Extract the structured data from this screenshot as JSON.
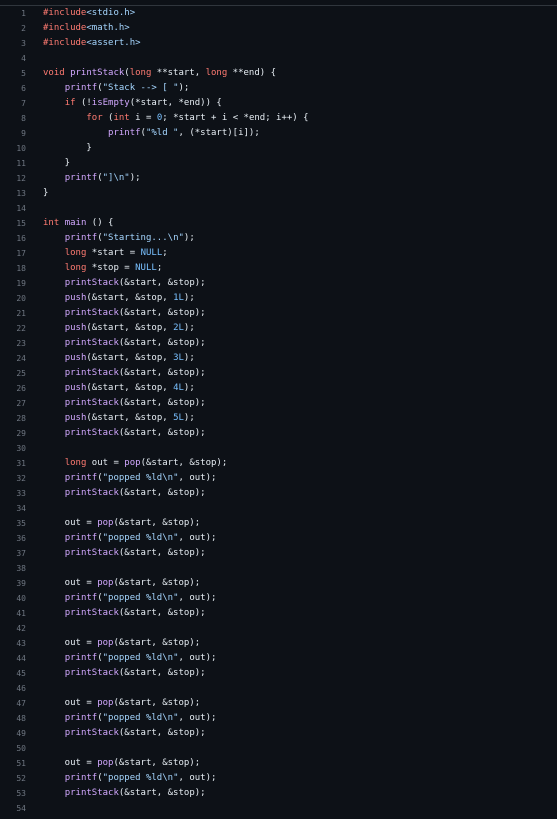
{
  "editor": {
    "lines": [
      {
        "n": "1",
        "tokens": [
          [
            "pre",
            "#include"
          ],
          [
            "str",
            "<stdio.h>"
          ]
        ]
      },
      {
        "n": "2",
        "tokens": [
          [
            "pre",
            "#include"
          ],
          [
            "str",
            "<math.h>"
          ]
        ]
      },
      {
        "n": "3",
        "tokens": [
          [
            "pre",
            "#include"
          ],
          [
            "str",
            "<assert.h>"
          ]
        ]
      },
      {
        "n": "4",
        "tokens": []
      },
      {
        "n": "5",
        "tokens": [
          [
            "kw",
            "void "
          ],
          [
            "fn",
            "printStack"
          ],
          [
            "plain",
            "("
          ],
          [
            "kw",
            "long "
          ],
          [
            "plain",
            "**start, "
          ],
          [
            "kw",
            "long "
          ],
          [
            "plain",
            "**end) {"
          ]
        ]
      },
      {
        "n": "6",
        "tokens": [
          [
            "plain",
            "    "
          ],
          [
            "fn",
            "printf"
          ],
          [
            "plain",
            "("
          ],
          [
            "str",
            "\"Stack --> [ \""
          ],
          [
            "plain",
            ");"
          ]
        ]
      },
      {
        "n": "7",
        "tokens": [
          [
            "plain",
            "    "
          ],
          [
            "kw",
            "if "
          ],
          [
            "plain",
            "(!"
          ],
          [
            "fn",
            "isEmpty"
          ],
          [
            "plain",
            "(*start, *end)) {"
          ]
        ]
      },
      {
        "n": "8",
        "tokens": [
          [
            "plain",
            "        "
          ],
          [
            "kw",
            "for "
          ],
          [
            "plain",
            "("
          ],
          [
            "kw",
            "int "
          ],
          [
            "plain",
            "i = "
          ],
          [
            "num",
            "0"
          ],
          [
            "plain",
            "; *start + i < *end; i++) {"
          ]
        ]
      },
      {
        "n": "9",
        "tokens": [
          [
            "plain",
            "            "
          ],
          [
            "fn",
            "printf"
          ],
          [
            "plain",
            "("
          ],
          [
            "str",
            "\"%ld \""
          ],
          [
            "plain",
            ", (*start)[i]);"
          ]
        ]
      },
      {
        "n": "10",
        "tokens": [
          [
            "plain",
            "        }"
          ]
        ]
      },
      {
        "n": "11",
        "tokens": [
          [
            "plain",
            "    }"
          ]
        ]
      },
      {
        "n": "12",
        "tokens": [
          [
            "plain",
            "    "
          ],
          [
            "fn",
            "printf"
          ],
          [
            "plain",
            "("
          ],
          [
            "str",
            "\"]\\n\""
          ],
          [
            "plain",
            ");"
          ]
        ]
      },
      {
        "n": "13",
        "tokens": [
          [
            "plain",
            "}"
          ]
        ]
      },
      {
        "n": "14",
        "tokens": []
      },
      {
        "n": "15",
        "tokens": [
          [
            "kw",
            "int "
          ],
          [
            "fn",
            "main "
          ],
          [
            "plain",
            "() {"
          ]
        ]
      },
      {
        "n": "16",
        "tokens": [
          [
            "plain",
            "    "
          ],
          [
            "fn",
            "printf"
          ],
          [
            "plain",
            "("
          ],
          [
            "str",
            "\"Starting...\\n\""
          ],
          [
            "plain",
            ");"
          ]
        ]
      },
      {
        "n": "17",
        "tokens": [
          [
            "plain",
            "    "
          ],
          [
            "kw",
            "long "
          ],
          [
            "plain",
            "*start = "
          ],
          [
            "const",
            "NULL"
          ],
          [
            "plain",
            ";"
          ]
        ]
      },
      {
        "n": "18",
        "tokens": [
          [
            "plain",
            "    "
          ],
          [
            "kw",
            "long "
          ],
          [
            "plain",
            "*stop = "
          ],
          [
            "const",
            "NULL"
          ],
          [
            "plain",
            ";"
          ]
        ]
      },
      {
        "n": "19",
        "tokens": [
          [
            "plain",
            "    "
          ],
          [
            "fn",
            "printStack"
          ],
          [
            "plain",
            "(&start, &stop);"
          ]
        ]
      },
      {
        "n": "20",
        "tokens": [
          [
            "plain",
            "    "
          ],
          [
            "fn",
            "push"
          ],
          [
            "plain",
            "(&start, &stop, "
          ],
          [
            "num",
            "1L"
          ],
          [
            "plain",
            ");"
          ]
        ]
      },
      {
        "n": "21",
        "tokens": [
          [
            "plain",
            "    "
          ],
          [
            "fn",
            "printStack"
          ],
          [
            "plain",
            "(&start, &stop);"
          ]
        ]
      },
      {
        "n": "22",
        "tokens": [
          [
            "plain",
            "    "
          ],
          [
            "fn",
            "push"
          ],
          [
            "plain",
            "(&start, &stop, "
          ],
          [
            "num",
            "2L"
          ],
          [
            "plain",
            ");"
          ]
        ]
      },
      {
        "n": "23",
        "tokens": [
          [
            "plain",
            "    "
          ],
          [
            "fn",
            "printStack"
          ],
          [
            "plain",
            "(&start, &stop);"
          ]
        ]
      },
      {
        "n": "24",
        "tokens": [
          [
            "plain",
            "    "
          ],
          [
            "fn",
            "push"
          ],
          [
            "plain",
            "(&start, &stop, "
          ],
          [
            "num",
            "3L"
          ],
          [
            "plain",
            ");"
          ]
        ]
      },
      {
        "n": "25",
        "tokens": [
          [
            "plain",
            "    "
          ],
          [
            "fn",
            "printStack"
          ],
          [
            "plain",
            "(&start, &stop);"
          ]
        ]
      },
      {
        "n": "26",
        "tokens": [
          [
            "plain",
            "    "
          ],
          [
            "fn",
            "push"
          ],
          [
            "plain",
            "(&start, &stop, "
          ],
          [
            "num",
            "4L"
          ],
          [
            "plain",
            ");"
          ]
        ]
      },
      {
        "n": "27",
        "tokens": [
          [
            "plain",
            "    "
          ],
          [
            "fn",
            "printStack"
          ],
          [
            "plain",
            "(&start, &stop);"
          ]
        ]
      },
      {
        "n": "28",
        "tokens": [
          [
            "plain",
            "    "
          ],
          [
            "fn",
            "push"
          ],
          [
            "plain",
            "(&start, &stop, "
          ],
          [
            "num",
            "5L"
          ],
          [
            "plain",
            ");"
          ]
        ]
      },
      {
        "n": "29",
        "tokens": [
          [
            "plain",
            "    "
          ],
          [
            "fn",
            "printStack"
          ],
          [
            "plain",
            "(&start, &stop);"
          ]
        ]
      },
      {
        "n": "30",
        "tokens": []
      },
      {
        "n": "31",
        "tokens": [
          [
            "plain",
            "    "
          ],
          [
            "kw",
            "long "
          ],
          [
            "plain",
            "out = "
          ],
          [
            "fn",
            "pop"
          ],
          [
            "plain",
            "(&start, &stop);"
          ]
        ]
      },
      {
        "n": "32",
        "tokens": [
          [
            "plain",
            "    "
          ],
          [
            "fn",
            "printf"
          ],
          [
            "plain",
            "("
          ],
          [
            "str",
            "\"popped %ld\\n\""
          ],
          [
            "plain",
            ", out);"
          ]
        ]
      },
      {
        "n": "33",
        "tokens": [
          [
            "plain",
            "    "
          ],
          [
            "fn",
            "printStack"
          ],
          [
            "plain",
            "(&start, &stop);"
          ]
        ]
      },
      {
        "n": "34",
        "tokens": []
      },
      {
        "n": "35",
        "tokens": [
          [
            "plain",
            "    out = "
          ],
          [
            "fn",
            "pop"
          ],
          [
            "plain",
            "(&start, &stop);"
          ]
        ]
      },
      {
        "n": "36",
        "tokens": [
          [
            "plain",
            "    "
          ],
          [
            "fn",
            "printf"
          ],
          [
            "plain",
            "("
          ],
          [
            "str",
            "\"popped %ld\\n\""
          ],
          [
            "plain",
            ", out);"
          ]
        ]
      },
      {
        "n": "37",
        "tokens": [
          [
            "plain",
            "    "
          ],
          [
            "fn",
            "printStack"
          ],
          [
            "plain",
            "(&start, &stop);"
          ]
        ]
      },
      {
        "n": "38",
        "tokens": []
      },
      {
        "n": "39",
        "tokens": [
          [
            "plain",
            "    out = "
          ],
          [
            "fn",
            "pop"
          ],
          [
            "plain",
            "(&start, &stop);"
          ]
        ]
      },
      {
        "n": "40",
        "tokens": [
          [
            "plain",
            "    "
          ],
          [
            "fn",
            "printf"
          ],
          [
            "plain",
            "("
          ],
          [
            "str",
            "\"popped %ld\\n\""
          ],
          [
            "plain",
            ", out);"
          ]
        ]
      },
      {
        "n": "41",
        "tokens": [
          [
            "plain",
            "    "
          ],
          [
            "fn",
            "printStack"
          ],
          [
            "plain",
            "(&start, &stop);"
          ]
        ]
      },
      {
        "n": "42",
        "tokens": []
      },
      {
        "n": "43",
        "tokens": [
          [
            "plain",
            "    out = "
          ],
          [
            "fn",
            "pop"
          ],
          [
            "plain",
            "(&start, &stop);"
          ]
        ]
      },
      {
        "n": "44",
        "tokens": [
          [
            "plain",
            "    "
          ],
          [
            "fn",
            "printf"
          ],
          [
            "plain",
            "("
          ],
          [
            "str",
            "\"popped %ld\\n\""
          ],
          [
            "plain",
            ", out);"
          ]
        ]
      },
      {
        "n": "45",
        "tokens": [
          [
            "plain",
            "    "
          ],
          [
            "fn",
            "printStack"
          ],
          [
            "plain",
            "(&start, &stop);"
          ]
        ]
      },
      {
        "n": "46",
        "tokens": []
      },
      {
        "n": "47",
        "tokens": [
          [
            "plain",
            "    out = "
          ],
          [
            "fn",
            "pop"
          ],
          [
            "plain",
            "(&start, &stop);"
          ]
        ]
      },
      {
        "n": "48",
        "tokens": [
          [
            "plain",
            "    "
          ],
          [
            "fn",
            "printf"
          ],
          [
            "plain",
            "("
          ],
          [
            "str",
            "\"popped %ld\\n\""
          ],
          [
            "plain",
            ", out);"
          ]
        ]
      },
      {
        "n": "49",
        "tokens": [
          [
            "plain",
            "    "
          ],
          [
            "fn",
            "printStack"
          ],
          [
            "plain",
            "(&start, &stop);"
          ]
        ]
      },
      {
        "n": "50",
        "tokens": []
      },
      {
        "n": "51",
        "tokens": [
          [
            "plain",
            "    out = "
          ],
          [
            "fn",
            "pop"
          ],
          [
            "plain",
            "(&start, &stop);"
          ]
        ]
      },
      {
        "n": "52",
        "tokens": [
          [
            "plain",
            "    "
          ],
          [
            "fn",
            "printf"
          ],
          [
            "plain",
            "("
          ],
          [
            "str",
            "\"popped %ld\\n\""
          ],
          [
            "plain",
            ", out);"
          ]
        ]
      },
      {
        "n": "53",
        "tokens": [
          [
            "plain",
            "    "
          ],
          [
            "fn",
            "printStack"
          ],
          [
            "plain",
            "(&start, &stop);"
          ]
        ]
      },
      {
        "n": "54",
        "tokens": []
      }
    ]
  },
  "colors": {
    "background": "#0d1117",
    "line_number": "#6e7681",
    "keyword": "#ff7b72",
    "function": "#d2a8ff",
    "string": "#a5d6ff",
    "number": "#79c0ff",
    "plain": "#e6edf3"
  }
}
